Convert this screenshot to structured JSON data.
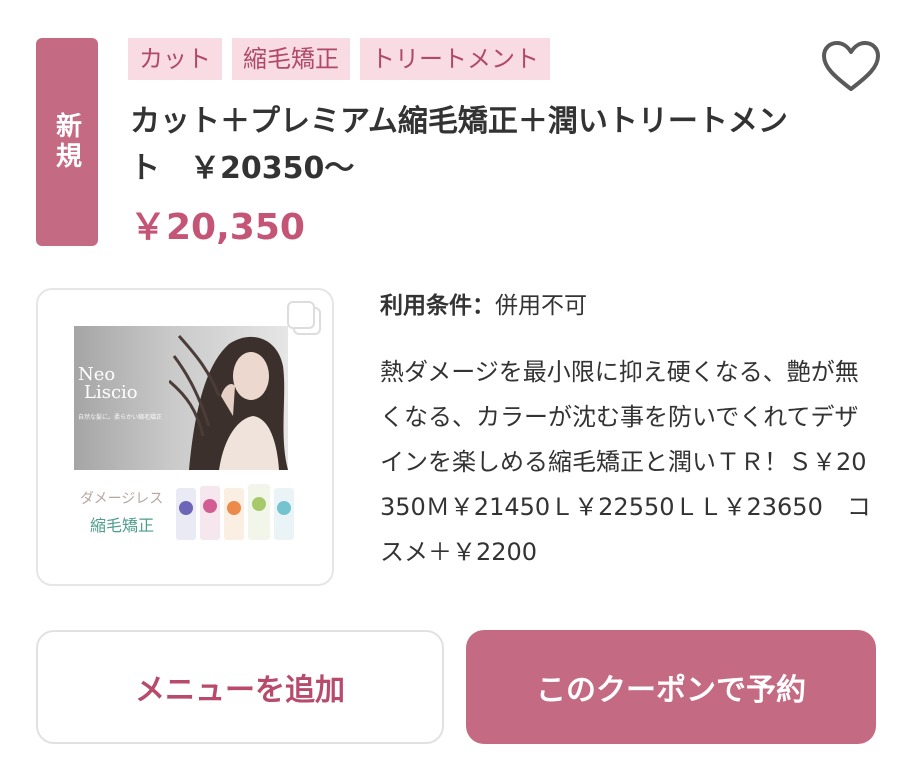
{
  "coupon": {
    "badge": "新規",
    "tags": [
      "カット",
      "縮毛矯正",
      "トリートメント"
    ],
    "title": "カット＋プレミアム縮毛矯正＋潤いトリートメント　￥20350～",
    "price": "￥20,350",
    "condition_label": "利用条件：",
    "condition_value": "併用不可",
    "description": "熱ダメージを最小限に抑え硬くなる、艶が無くなる、カラーが沈む事を防いでくれてデザインを楽しめる縮毛矯正と潤いＴＲ！Ｓ￥20350Ｍ￥21450Ｌ￥22550ＬＬ￥23650　コスメ＋￥2200",
    "image": {
      "brand_line1": "Neo",
      "brand_line2": "Liscio",
      "brand_sub": "自然な髪に。柔らかい縮毛矯正",
      "promo_line1": "ダメージレス",
      "promo_line2": "縮毛矯正"
    }
  },
  "actions": {
    "add_menu": "メニューを追加",
    "reserve": "このクーポンで予約"
  },
  "icons": {
    "favorite": "heart-outline-icon",
    "gallery": "gallery-stack-icon"
  },
  "colors": {
    "accent": "#c46a83",
    "price": "#c45577",
    "tag_bg": "#f8dbe3",
    "tag_text": "#b04a68"
  }
}
